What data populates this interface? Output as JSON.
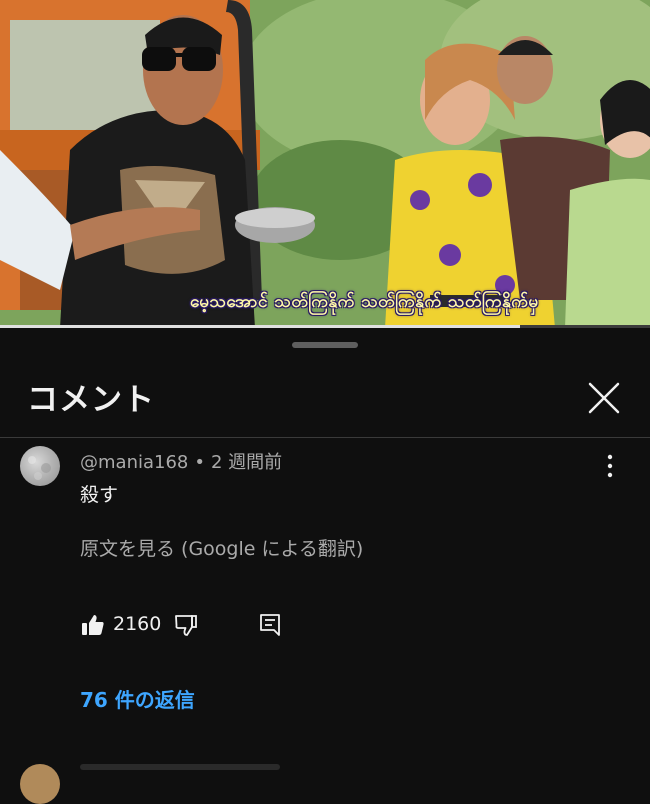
{
  "video": {
    "subtitle": "မေ့သအောင် သတ်ကြနိုက် သတ်ကြနိုက် သတ်ကြနိုက်မှ",
    "progress": 0.8
  },
  "comments_panel": {
    "title": "コメント",
    "close_icon": "close-icon",
    "comment": {
      "author": "@mania168",
      "separator": "•",
      "time": "2 週間前",
      "text": "殺す",
      "translate_link": "原文を見る (Google による翻訳)",
      "like_count": "2160",
      "replies_link": "76 件の返信"
    }
  },
  "colors": {
    "background": "#0f0f0f",
    "text": "#f1f1f1",
    "secondary_text": "#aaaaaa",
    "link": "#3ea6ff"
  }
}
